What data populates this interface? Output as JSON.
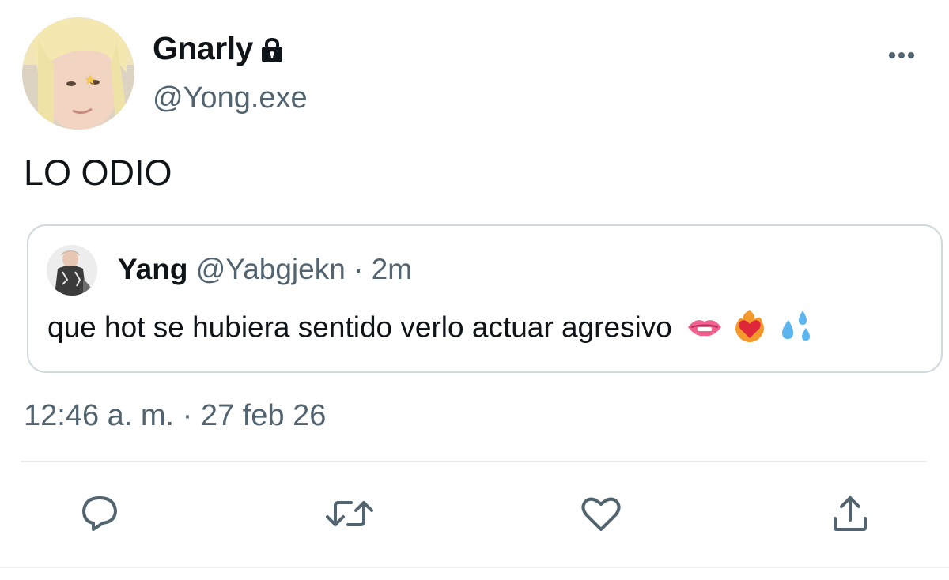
{
  "author": {
    "display_name": "Gnarly",
    "handle": "@Yong.exe",
    "avatar_icon": "user-avatar-photo",
    "protected_icon": "lock-icon"
  },
  "tweet": {
    "text": "LO ODIO",
    "timestamp": "12:46 a. m. · 27 feb 26"
  },
  "quoted_tweet": {
    "display_name": "Yang",
    "meta": "@Yabgjekn · 2m",
    "text": "que hot se hubiera sentido verlo actuar agresivo",
    "emojis": [
      "biting-lip-emoji",
      "heart-on-fire-emoji",
      "sweat-droplets-emoji"
    ]
  },
  "actions": {
    "more": "more-options-icon",
    "reply": "reply-icon",
    "retweet": "retweet-icon",
    "like": "like-icon",
    "share": "share-icon"
  },
  "colors": {
    "text_primary": "#0f1419",
    "text_secondary": "#536471",
    "border": "#cfd9de",
    "icon": "#536471"
  }
}
